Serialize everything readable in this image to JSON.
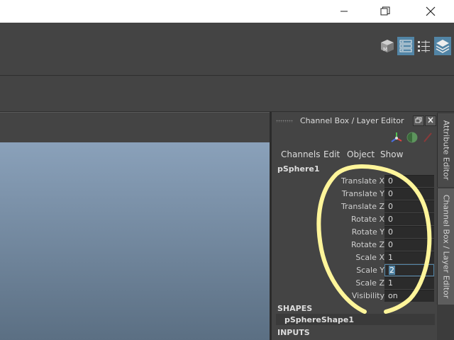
{
  "window_controls": {
    "minimize_icon": "minimize-icon",
    "restore_icon": "restore-icon",
    "close_icon": "close-icon"
  },
  "toolbar_icons": [
    "modeling-toolkit-icon",
    "attribute-editor-toggle-icon",
    "tool-settings-icon",
    "channel-box-layer-editor-icon"
  ],
  "panel": {
    "title": "Channel Box / Layer Editor",
    "menus": [
      "Channels",
      "Edit",
      "Object",
      "Show"
    ],
    "object_name": "pSphere1",
    "channels": [
      {
        "label": "Translate X",
        "value": "0"
      },
      {
        "label": "Translate Y",
        "value": "0"
      },
      {
        "label": "Translate Z",
        "value": "0"
      },
      {
        "label": "Rotate X",
        "value": "0"
      },
      {
        "label": "Rotate Y",
        "value": "0"
      },
      {
        "label": "Rotate Z",
        "value": "0"
      },
      {
        "label": "Scale X",
        "value": "1"
      },
      {
        "label": "Scale Y",
        "value": "2"
      },
      {
        "label": "Scale Z",
        "value": "1"
      },
      {
        "label": "Visibility",
        "value": "on"
      }
    ],
    "shapes_label": "SHAPES",
    "shape_name": "pSphereShape1",
    "inputs_label": "INPUTS"
  },
  "side_tabs": {
    "attribute_editor": "Attribute Editor",
    "channel_box": "Channel Box / Layer Editor"
  },
  "colors": {
    "accent": "#5285a6",
    "annotation": "#fff59a",
    "panel_bg": "#444444",
    "viewport_top": "#8aa1ba",
    "viewport_bottom": "#5b6f83"
  }
}
